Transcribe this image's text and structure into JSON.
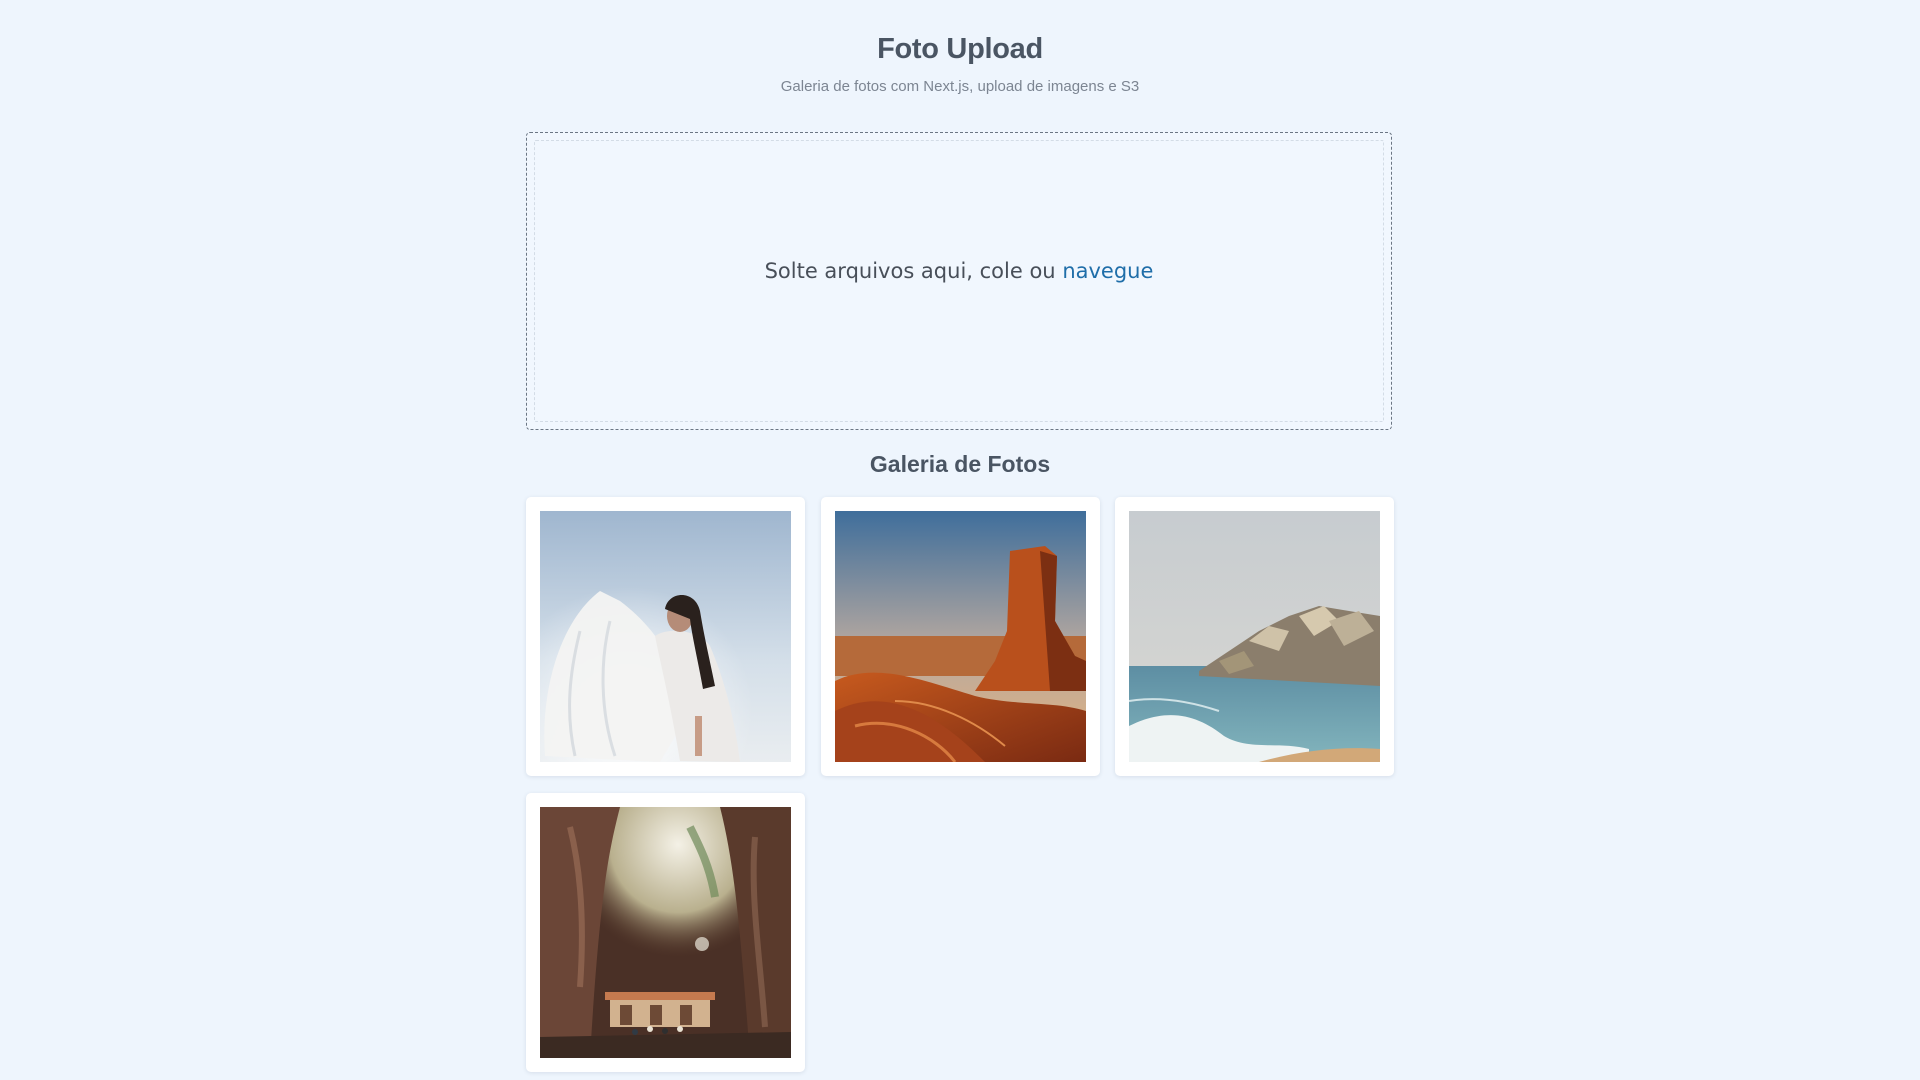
{
  "header": {
    "title": "Foto Upload",
    "subtitle": "Galeria de fotos com Next.js, upload de imagens e S3"
  },
  "dropzone": {
    "text": "Solte arquivos aqui, cole ou",
    "link": "navegue"
  },
  "gallery": {
    "title": "Galeria de Fotos",
    "photos": [
      {
        "subject": "woman in white flowing dress against sky"
      },
      {
        "subject": "red rock butte in desert at sunset"
      },
      {
        "subject": "sea waves breaking near rock breakwater"
      },
      {
        "subject": "cave interior with temple and people"
      }
    ]
  },
  "colors": {
    "background": "#eef5fd",
    "title": "#4a5563",
    "link": "#1f6ea9"
  }
}
